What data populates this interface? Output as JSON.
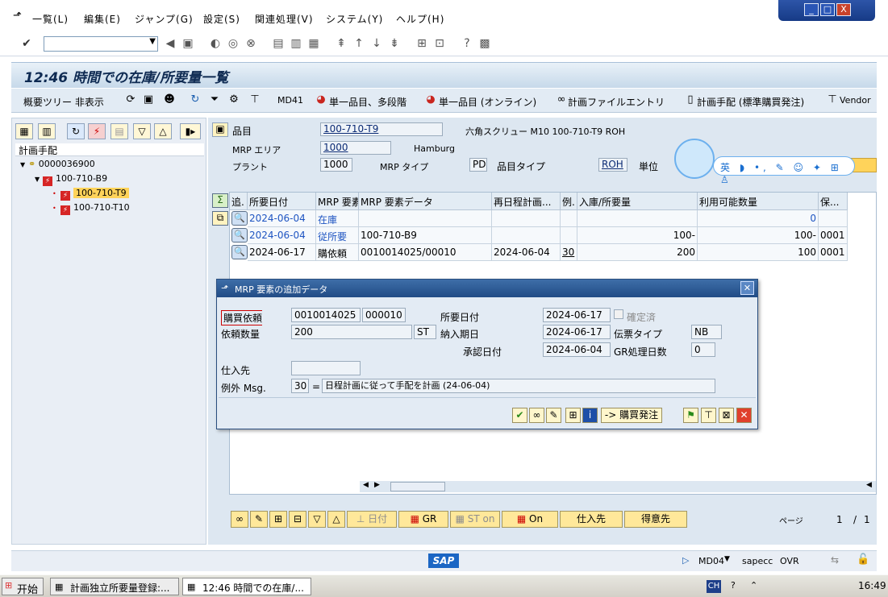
{
  "menu": {
    "items": [
      "一覧(L)",
      "編集(E)",
      "ジャンプ(G)",
      "設定(S)",
      "関連処理(V)",
      "システム(Y)",
      "ヘルプ(H)"
    ]
  },
  "window_controls": {
    "minimize": "_",
    "restore": "□",
    "close": "X"
  },
  "screen_title": "12:46 時間での在庫/所要量一覧",
  "app_toolbar": {
    "overview_tree": "概要ツリー 非表示",
    "md41": "MD41",
    "single_item_multi": "単一品目、多段階",
    "single_item_online": "単一品目 (オンライン)",
    "planning_file": "計画ファイルエントリ",
    "procurement": "計画手配 (標準購買発注)",
    "vendor": "Vendor"
  },
  "left_panel": {
    "header": "計画手配",
    "tree": [
      {
        "label": "0000036900",
        "level": 0
      },
      {
        "label": "100-710-B9",
        "level": 1
      },
      {
        "label": "100-710-T9",
        "level": 2,
        "selected": true
      },
      {
        "label": "100-710-T10",
        "level": 2
      }
    ]
  },
  "header_fields": {
    "material_label": "品目",
    "material_value": "100-710-T9",
    "material_desc": "六角スクリュー M10 100-710-T9 ROH",
    "mrp_area_label": "MRP エリア",
    "mrp_area_value": "1000",
    "mrp_area_desc": "Hamburg",
    "plant_label": "プラント",
    "plant_value": "1000",
    "mrp_type_label": "MRP タイプ",
    "mrp_type_value": "PD",
    "material_type_label": "品目タイプ",
    "material_type_value": "ROH",
    "unit_label": "単位"
  },
  "grid": {
    "columns": [
      "追.",
      "所要日付",
      "MRP 要素",
      "MRP 要素データ",
      "再日程計画...",
      "例.",
      "入庫/所要量",
      "利用可能数量",
      "保..."
    ],
    "rows": [
      {
        "date": "2024-06-04",
        "element": "在庫",
        "data": "",
        "resched": "",
        "exc": "",
        "qty": "",
        "avail": "0",
        "stor": ""
      },
      {
        "date": "2024-06-04",
        "element": "従所要",
        "data": "100-710-B9",
        "resched": "",
        "exc": "",
        "qty": "100-",
        "avail": "100-",
        "stor": "0001"
      },
      {
        "date": "2024-06-17",
        "element": "購依頼",
        "data": "0010014025/00010",
        "resched": "2024-06-04",
        "exc": "30",
        "qty": "200",
        "avail": "100",
        "stor": "0001"
      }
    ]
  },
  "popup": {
    "title": "MRP 要素の追加データ",
    "pr_label": "購買依頼",
    "pr_number": "0010014025",
    "pr_item": "000010",
    "req_date_label": "所要日付",
    "req_date_value": "2024-06-17",
    "fixed_label": "確定済",
    "qty_label": "依頼数量",
    "qty_value": "200",
    "qty_unit": "ST",
    "delivery_label": "納入期日",
    "delivery_value": "2024-06-17",
    "doc_type_label": "伝票タイプ",
    "doc_type_value": "NB",
    "release_label": "承認日付",
    "release_value": "2024-06-04",
    "gr_days_label": "GR処理日数",
    "gr_days_value": "0",
    "vendor_label": "仕入先",
    "vendor_value": "",
    "exception_label": "例外 Msg.",
    "exception_code": "30",
    "exception_eq": "=",
    "exception_text": "日程計画に従って手配を計画 (24-06-04)",
    "convert_button": "-> 購買発注"
  },
  "bottom_buttons": {
    "date": "日付",
    "gr": "GR",
    "st_on": "ST on",
    "on": "On",
    "vendor": "仕入先",
    "customer": "得意先"
  },
  "paging": {
    "label": "ページ",
    "current": "1",
    "sep": "/",
    "total": "1"
  },
  "status": {
    "transaction": "MD04",
    "server": "sapecc",
    "mode": "OVR"
  },
  "taskbar": {
    "start": "开始",
    "task1": "計画独立所要量登録:...",
    "task2": "12:46 時間での在庫/...",
    "ime": "CH",
    "clock": "16:49"
  },
  "assistant": {
    "text": "英 ◗ •, ✎ ☺ ✦ ⊞ ♙"
  },
  "colors": {
    "accent": "#214c86",
    "button": "#ffe89a",
    "selection": "#ffd35a",
    "link": "#1f55c2"
  }
}
